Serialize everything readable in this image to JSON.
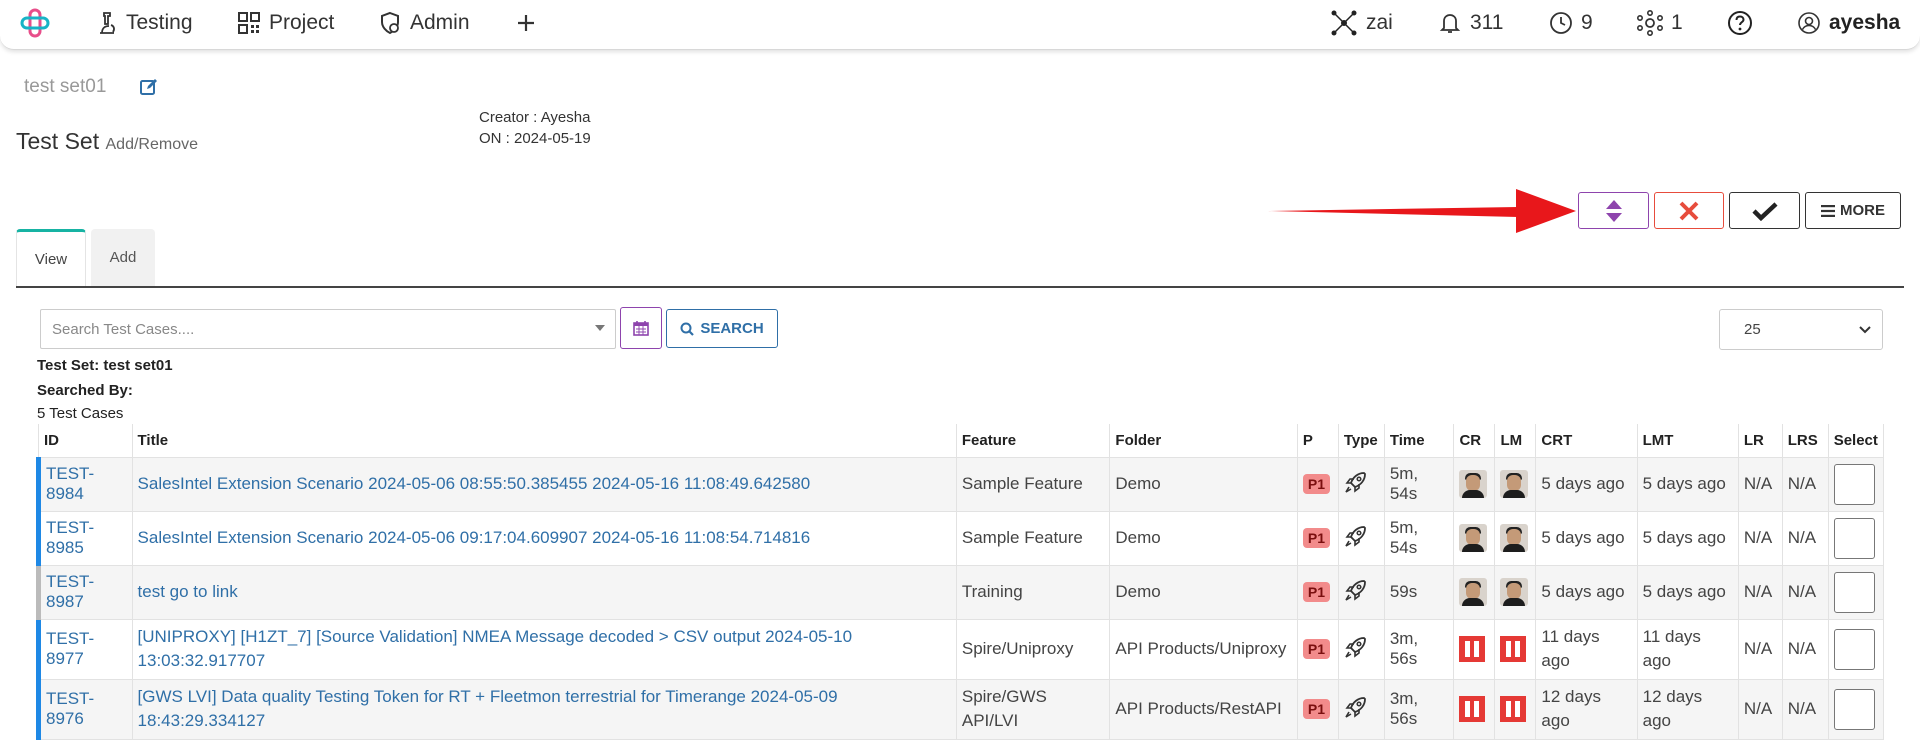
{
  "nav": {
    "testing": "Testing",
    "project": "Project",
    "admin": "Admin",
    "zai": "zai",
    "notifications": "311",
    "history": "9",
    "network": "1",
    "user": "ayesha"
  },
  "header": {
    "set_name": "test set01",
    "section_label": "Test Set",
    "section_sub": "Add/Remove",
    "creator": "Creator : Ayesha",
    "created_on": "ON : 2024-05-19"
  },
  "actions": {
    "more_label": "MORE"
  },
  "tabs": {
    "view": "View",
    "add": "Add"
  },
  "search": {
    "placeholder": "Search Test Cases....",
    "button_label": "SEARCH",
    "page_size": "25"
  },
  "info": {
    "test_set_label": "Test Set: test set01",
    "searched_by_label": "Searched By:",
    "count_label": "5 Test Cases"
  },
  "table": {
    "headers": [
      "ID",
      "Title",
      "Feature",
      "Folder",
      "P",
      "Type",
      "Time",
      "CR",
      "LM",
      "CRT",
      "LMT",
      "LR",
      "LRS",
      "Select"
    ],
    "rows": [
      {
        "id": "TEST-8984",
        "title": "SalesIntel Extension Scenario 2024-05-06 08:55:50.385455 2024-05-16 11:08:49.642580",
        "feature": "Sample Feature",
        "folder": "Demo",
        "p": "P1",
        "time": "5m, 54s",
        "crt": "5 days ago",
        "lmt": "5 days ago",
        "lr": "N/A",
        "lrs": "N/A"
      },
      {
        "id": "TEST-8985",
        "title": "SalesIntel Extension Scenario 2024-05-06 09:17:04.609907 2024-05-16 11:08:54.714816",
        "feature": "Sample Feature",
        "folder": "Demo",
        "p": "P1",
        "time": "5m, 54s",
        "crt": "5 days ago",
        "lmt": "5 days ago",
        "lr": "N/A",
        "lrs": "N/A"
      },
      {
        "id": "TEST-8987",
        "title": "test go to link",
        "feature": "Training",
        "folder": "Demo",
        "p": "P1",
        "time": "59s",
        "crt": "5 days ago",
        "lmt": "5 days ago",
        "lr": "N/A",
        "lrs": "N/A"
      },
      {
        "id": "TEST-8977",
        "title": "[UNIPROXY] [H1ZT_7] [Source Validation] NMEA Message decoded > CSV output 2024-05-10 13:03:32.917707",
        "feature": "Spire/Uniproxy",
        "folder": "API Products/Uniproxy",
        "p": "P1",
        "time": "3m, 56s",
        "crt": "11 days ago",
        "lmt": "11 days ago",
        "lr": "N/A",
        "lrs": "N/A"
      },
      {
        "id": "TEST-8976",
        "title": "[GWS LVI] Data quality Testing Token for RT + Fleetmon terrestrial for Timerange 2024-05-09 18:43:29.334127",
        "feature": "Spire/GWS API/LVI",
        "folder": "API Products/RestAPI",
        "p": "P1",
        "time": "3m, 56s",
        "crt": "12 days ago",
        "lmt": "12 days ago",
        "lr": "N/A",
        "lrs": "N/A"
      }
    ]
  },
  "colors": {
    "accent_teal": "#17b3a3",
    "link_blue": "#2f6fa7",
    "purple": "#8e44ad",
    "danger_red": "#e74c3c",
    "annotation_arrow": "#e8171b"
  }
}
